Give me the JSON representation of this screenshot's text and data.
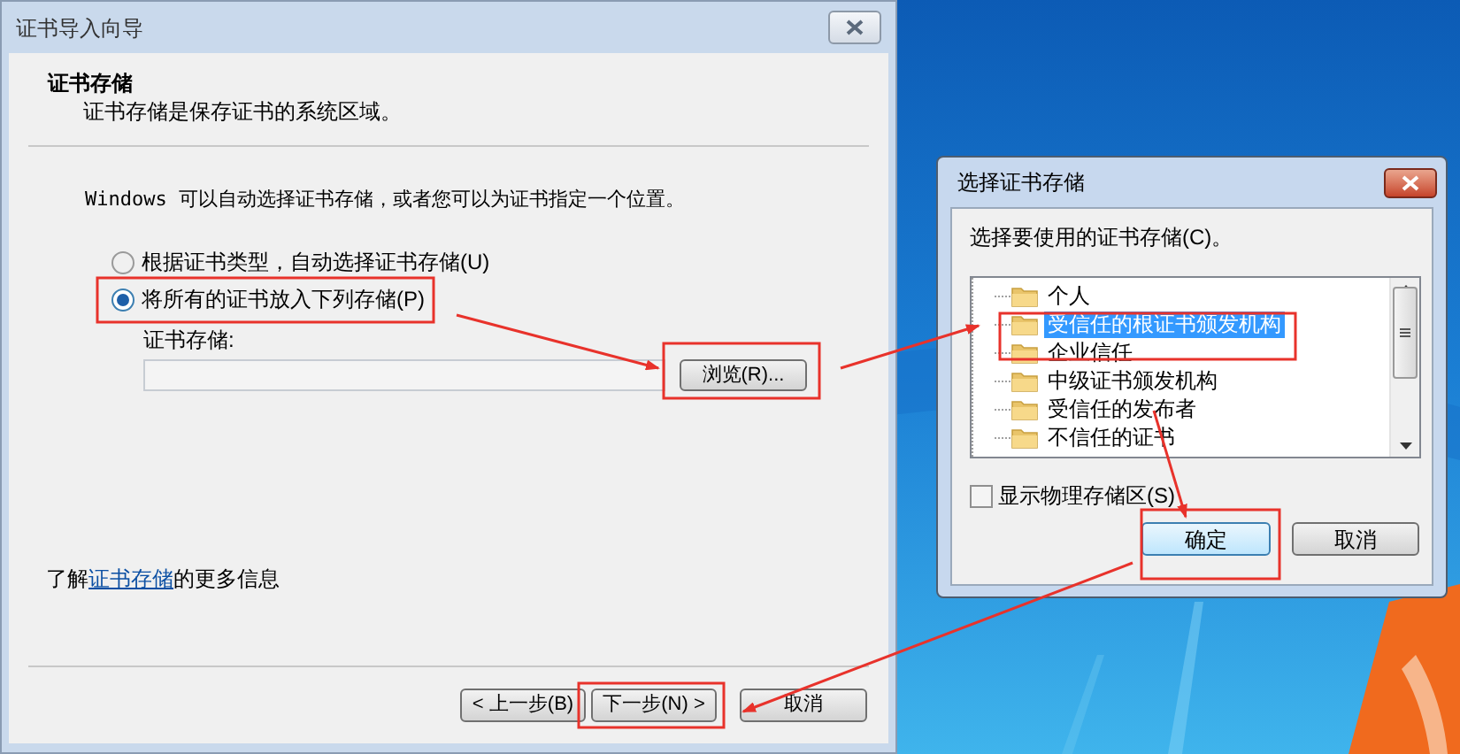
{
  "wizard": {
    "title": "证书导入向导",
    "heading": "证书存储",
    "subtitle": "证书存储是保存证书的系统区域。",
    "intro": "Windows 可以自动选择证书存储，或者您可以为证书指定一个位置。",
    "options": [
      {
        "label": "根据证书类型，自动选择证书存储(U)",
        "selected": false
      },
      {
        "label": "将所有的证书放入下列存储(P)",
        "selected": true
      }
    ],
    "store_label": "证书存储:",
    "browse_button": "浏览(R)...",
    "more_info": {
      "before": "了解",
      "link": "证书存储",
      "after": "的更多信息"
    },
    "buttons": [
      "< 上一步(B)",
      "下一步(N) >",
      "取消"
    ]
  },
  "store_dialog": {
    "title": "选择证书存储",
    "prompt": "选择要使用的证书存储(C)。",
    "stores": [
      {
        "label": "个人",
        "selected": false
      },
      {
        "label": "受信任的根证书颁发机构",
        "selected": true
      },
      {
        "label": "企业信任",
        "selected": false
      },
      {
        "label": "中级证书颁发机构",
        "selected": false
      },
      {
        "label": "受信任的发布者",
        "selected": false
      },
      {
        "label": "不信任的证书",
        "selected": false
      }
    ],
    "show_physical": {
      "label": "显示物理存储区(S)",
      "checked": false
    },
    "buttons": [
      "确定",
      "取消"
    ]
  }
}
